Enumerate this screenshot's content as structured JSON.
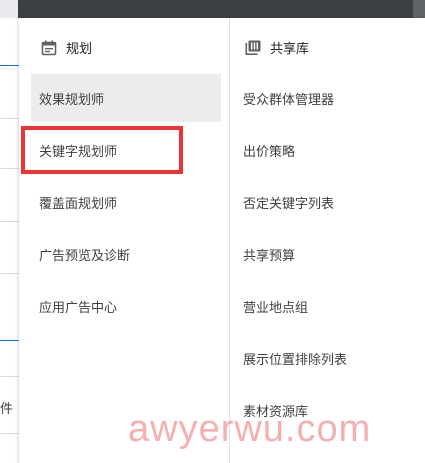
{
  "planning": {
    "heading": "规划",
    "items": [
      {
        "label": "效果规划师",
        "active": true
      },
      {
        "label": "关键字规划师",
        "highlighted": true
      },
      {
        "label": "覆盖面规划师"
      },
      {
        "label": "广告预览及诊断"
      },
      {
        "label": "应用广告中心"
      }
    ]
  },
  "shared_library": {
    "heading": "共享库",
    "items": [
      {
        "label": "受众群体管理器"
      },
      {
        "label": "出价策略"
      },
      {
        "label": "否定关键字列表"
      },
      {
        "label": "共享预算"
      },
      {
        "label": "营业地点组"
      },
      {
        "label": "展示位置排除列表"
      },
      {
        "label": "素材资源库"
      }
    ]
  },
  "background": {
    "partial_text": "件"
  },
  "watermark": "awyerwu.com",
  "colors": {
    "highlight_box": "#ee3333",
    "active_item_bg": "#ececec",
    "accent_blue": "#1a73e8"
  },
  "icons": {
    "planning": "calendar-icon",
    "shared_library": "library-icon"
  }
}
